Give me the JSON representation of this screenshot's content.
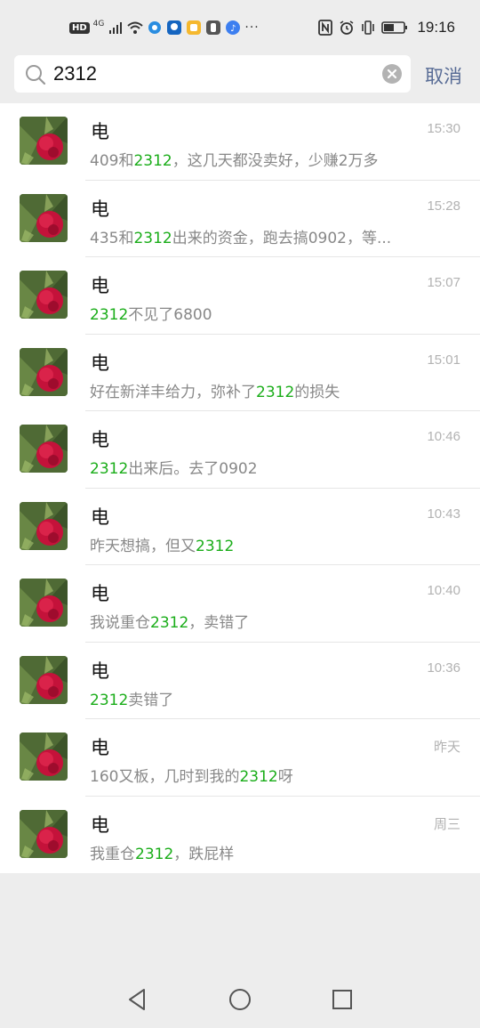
{
  "status_bar": {
    "network_badge": "HD",
    "network_type": "4G",
    "more": "···",
    "time": "19:16"
  },
  "search": {
    "query": "2312",
    "cancel_label": "取消"
  },
  "results": [
    {
      "name": "电",
      "time": "15:30",
      "pre": "409和",
      "hl": "2312",
      "post": "，这几天都没卖好，少赚2万多"
    },
    {
      "name": "电",
      "time": "15:28",
      "pre": "435和",
      "hl": "2312",
      "post": "出来的资金，跑去搞0902，等..."
    },
    {
      "name": "电",
      "time": "15:07",
      "pre": "",
      "hl": "2312",
      "post": "不见了6800"
    },
    {
      "name": "电",
      "time": "15:01",
      "pre": "好在新洋丰给力，弥补了",
      "hl": "2312",
      "post": "的损失"
    },
    {
      "name": "电",
      "time": "10:46",
      "pre": "",
      "hl": "2312",
      "post": "出来后。去了0902"
    },
    {
      "name": "电",
      "time": "10:43",
      "pre": "昨天想搞，但又",
      "hl": "2312",
      "post": ""
    },
    {
      "name": "电",
      "time": "10:40",
      "pre": "我说重仓",
      "hl": "2312",
      "post": "，卖错了"
    },
    {
      "name": "电",
      "time": "10:36",
      "pre": "",
      "hl": "2312",
      "post": "卖错了"
    },
    {
      "name": "电",
      "time": "昨天",
      "pre": "160又板，几时到我的",
      "hl": "2312",
      "post": "呀"
    },
    {
      "name": "电",
      "time": "周三",
      "pre": "我重仓",
      "hl": "2312",
      "post": "，跌屁样"
    }
  ],
  "colors": {
    "highlight": "#1aad19",
    "cancel": "#576b95",
    "background": "#ededed"
  },
  "icons": {
    "nav_back": "triangle-back-icon",
    "nav_home": "circle-home-icon",
    "nav_recents": "square-recents-icon"
  }
}
